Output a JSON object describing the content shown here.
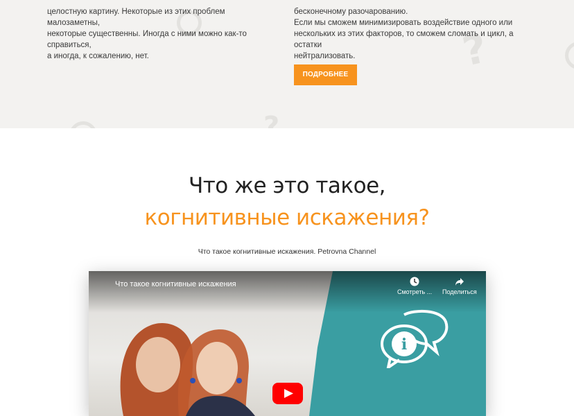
{
  "top": {
    "left_lines": [
      "целостную картину. Некоторые из этих проблем малозаметны,",
      "некоторые существенны. Иногда с ними можно как-то справиться,",
      "а иногда, к сожалению, нет."
    ],
    "right_lines": [
      "бесконечному разочарованию.",
      "Если мы сможем минимизировать воздействие одного или",
      "нескольких из этих факторов, то сможем сломать и цикл, а остатки",
      "нейтрализовать."
    ],
    "more_button": "ПОДРОБНЕЕ"
  },
  "section": {
    "heading_line1": "Что же это такое,",
    "heading_line2": "когнитивные искажения?",
    "video_caption": "Что такое когнитивные искажения. Petrovna Channel"
  },
  "video": {
    "title": "Что такое когнитивные искажения",
    "watch_label": "Смотреть ...",
    "share_label": "Поделиться"
  },
  "colors": {
    "accent": "#f7931e",
    "top_bg": "#f3f2f0",
    "video_teal": "#3a9ea2",
    "youtube_red": "#ff0000"
  }
}
